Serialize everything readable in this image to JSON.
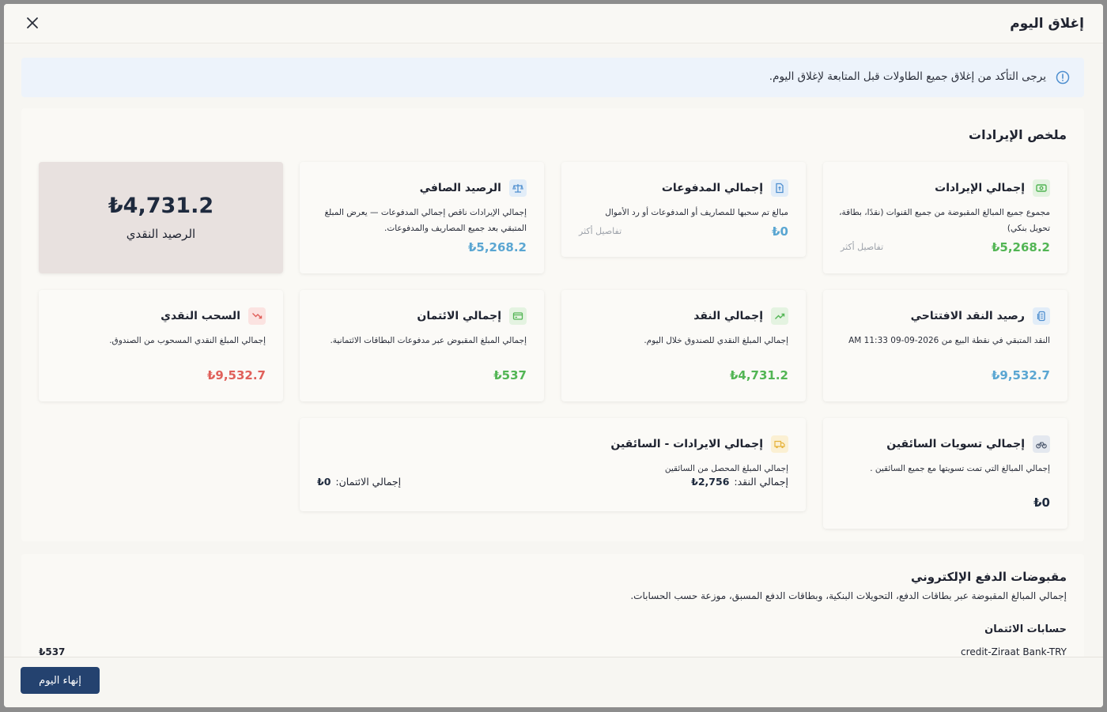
{
  "modal": {
    "title": "إغلاق اليوم"
  },
  "alert": {
    "text": "يرجى التأكد من إغلاق جميع الطاولات قبل المتابعة لإغلاق اليوم."
  },
  "summary": {
    "title": "ملخص الإيرادات",
    "cash_balance": {
      "value": "₺4,731.2",
      "label": "الرصيد النقدي"
    },
    "cards": {
      "total_revenue": {
        "title": "إجمالي الإيرادات",
        "desc": "مجموع جميع المبالغ المقبوضة من جميع القنوات (نقدًا، بطاقة، تحويل بنكي)",
        "value": "₺5,268.2",
        "link": "تفاصيل أكثر"
      },
      "total_payments": {
        "title": "إجمالي المدفوعات",
        "desc": "مبالغ تم سحبها للمصاريف أو المدفوعات أو رد الأموال",
        "value": "₺0",
        "link": "تفاصيل أكثر"
      },
      "net_balance": {
        "title": "الرصيد الصافي",
        "desc": "إجمالي الإيرادات ناقص إجمالي المدفوعات — يعرض المبلغ المتبقي بعد جميع المصاريف والمدفوعات.",
        "value": "₺5,268.2"
      },
      "opening_cash": {
        "title": "رصيد النقد الافتتاحي",
        "desc": "النقد المتبقي في نقطة البيع من 2026-09-09 11:33 AM",
        "value": "₺9,532.7"
      },
      "total_cash": {
        "title": "إجمالي النقد",
        "desc": "إجمالي المبلغ النقدي للصندوق خلال اليوم.",
        "value": "₺4,731.2"
      },
      "total_credit": {
        "title": "إجمالي الائتمان",
        "desc": "إجمالي المبلغ المقبوض عبر مدفوعات البطاقات الائتمانية.",
        "value": "₺537"
      },
      "cash_withdrawal": {
        "title": "السحب النقدي",
        "desc": "إجمالي المبلغ النقدي المسحوب من الصندوق.",
        "value": "₺9,532.7"
      },
      "driver_settlements": {
        "title": "إجمالي تسويات السائقين",
        "desc": "إجمالي المبالغ التي تمت تسويتها مع جميع السائقين .",
        "value": "₺0"
      },
      "driver_revenue": {
        "title": "إجمالي الايرادات - السائقين",
        "desc": "إجمالي المبلغ المحصل من السائقين",
        "cash_label": "إجمالي النقد:",
        "cash_value": "₺2,756",
        "credit_label": "إجمالي الائتمان:",
        "credit_value": "₺0"
      }
    }
  },
  "epay": {
    "title": "مقبوضات الدفع الإلكتروني",
    "desc": "إجمالي المبالغ المقبوضة عبر بطاقات الدفع، التحويلات البنكية، وبطاقات الدفع المسبق، موزعة حسب الحسابات.",
    "credit_accounts_title": "حسابات الائتمان",
    "rows": [
      {
        "name": "credit-Ziraat Bank-TRY",
        "amount": "₺537"
      }
    ]
  },
  "footer": {
    "end_day_label": "إنهاء اليوم"
  },
  "colors": {
    "primary_button": "#24426f",
    "positive": "#52b554",
    "info": "#5aa6d2",
    "negative": "#e0605a",
    "alert_bg": "#edf3fb",
    "cash_card_bg": "#e8e1df"
  },
  "icons": {
    "close": "close-icon",
    "alert": "info-circle-icon",
    "total_revenue": "money-icon",
    "total_payments": "document-icon",
    "net_balance": "scale-icon",
    "opening_cash": "coins-icon",
    "total_cash": "trend-up-icon",
    "total_credit": "credit-card-icon",
    "cash_withdrawal": "trend-down-icon",
    "driver_settlements": "bicycle-icon",
    "driver_revenue": "truck-icon"
  }
}
